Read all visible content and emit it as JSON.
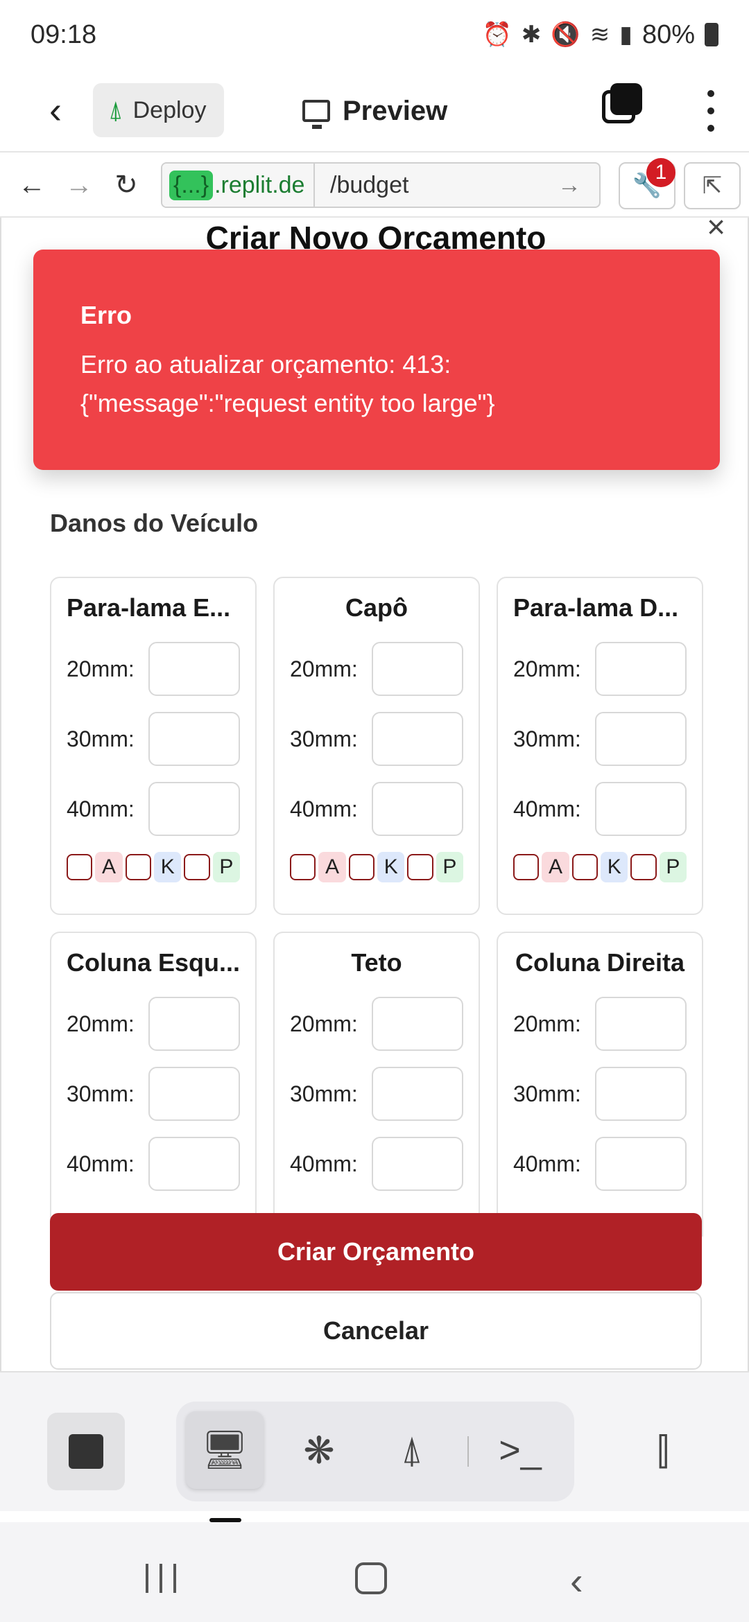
{
  "status_bar": {
    "time": "09:18",
    "icons": [
      "alarm-icon",
      "bluetooth-icon",
      "mute-icon",
      "wifi-icon",
      "signal-icon"
    ],
    "battery": "80%"
  },
  "topbar": {
    "deploy_label": "Deploy",
    "preview_label": "Preview"
  },
  "urlbar": {
    "badge": "{...}",
    "domain": ".replit.de",
    "path": "/budget",
    "notification_count": "1"
  },
  "modal": {
    "title": "Criar Novo Orçamento",
    "close": "×"
  },
  "toast": {
    "title": "Erro",
    "message": "Erro ao atualizar orçamento: 413: {\"message\":\"request entity too large\"}",
    "color": "#ef4247"
  },
  "section": {
    "title": "Danos do Veículo"
  },
  "cards": [
    {
      "title": "Para-lama E...",
      "fields": [
        "20mm:",
        "30mm:",
        "40mm:"
      ],
      "tags": [
        "A",
        "K",
        "P"
      ]
    },
    {
      "title": "Capô",
      "fields": [
        "20mm:",
        "30mm:",
        "40mm:"
      ],
      "tags": [
        "A",
        "K",
        "P"
      ]
    },
    {
      "title": "Para-lama D...",
      "fields": [
        "20mm:",
        "30mm:",
        "40mm:"
      ],
      "tags": [
        "A",
        "K",
        "P"
      ]
    },
    {
      "title": "Coluna Esqu...",
      "fields": [
        "20mm:",
        "30mm:",
        "40mm:"
      ]
    },
    {
      "title": "Teto",
      "fields": [
        "20mm:",
        "30mm:",
        "40mm:"
      ]
    },
    {
      "title": "Coluna Direita",
      "fields": [
        "20mm:",
        "30mm:",
        "40mm:"
      ]
    }
  ],
  "buttons": {
    "primary": "Criar Orçamento",
    "secondary": "Cancelar",
    "primary_color": "#b02126"
  }
}
